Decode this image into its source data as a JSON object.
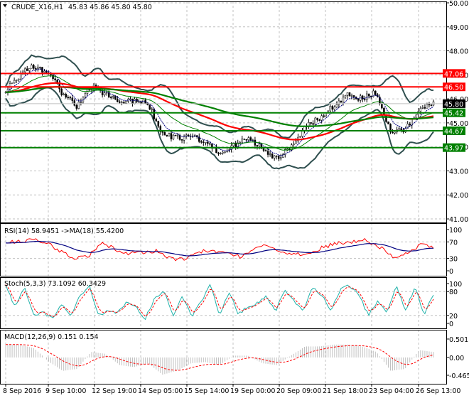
{
  "header": {
    "symbol": "CRUDE_X16,H1",
    "ohlc": "45.83 45.86 45.80 45.80"
  },
  "colors": {
    "up_level": "#ff0000",
    "down_level": "#008000",
    "bands": "#2f4f4f",
    "ma_fast": "#ff0000",
    "ma_slow": "#008000",
    "rsi": "#ff0000",
    "rsi_ma": "#000080",
    "stoch_main": "#20b2aa",
    "stoch_signal": "#ff0000",
    "macd_hist": "#c0c0c0"
  },
  "chart_data": [
    {
      "type": "line",
      "title": "CRUDE_X16,H1",
      "ylim": [
        41,
        50
      ],
      "yticks": [
        "50.00",
        "49.00",
        "48.00",
        "47.00",
        "46.00",
        "45.00",
        "44.00",
        "43.00",
        "42.00",
        "41.00"
      ],
      "xticks": [
        "8 Sep 2016",
        "9 Sep 10:00",
        "12 Sep 19:00",
        "14 Sep 05:00",
        "15 Sep 14:00",
        "19 Sep 00:00",
        "20 Sep 09:00",
        "21 Sep 18:00",
        "23 Sep 04:00",
        "26 Sep 13:00"
      ],
      "close": [
        46.4,
        47.0,
        47.4,
        47.1,
        46.2,
        45.7,
        46.5,
        46.2,
        45.9,
        45.9,
        45.8,
        44.5,
        44.4,
        44.4,
        44.2,
        43.7,
        44.1,
        44.3,
        44.0,
        43.5,
        44.0,
        44.8,
        45.2,
        45.7,
        46.2,
        46.0,
        46.3,
        44.6,
        44.7,
        45.5,
        45.8
      ],
      "current_price": "45.80",
      "levels": [
        {
          "value": "47.06",
          "kind": "resistance"
        },
        {
          "value": "46.50",
          "kind": "resistance"
        },
        {
          "value": "45.42",
          "kind": "support"
        },
        {
          "value": "44.67",
          "kind": "support"
        },
        {
          "value": "43.97",
          "kind": "support"
        }
      ]
    },
    {
      "type": "line",
      "title": "RSI(14) 58.9451  ->MA(18) 55.4200",
      "ylim": [
        0,
        100
      ],
      "yticks": [
        "100",
        "70",
        "30",
        "0"
      ],
      "values": [
        72,
        70,
        78,
        66,
        48,
        28,
        35,
        66,
        52,
        42,
        46,
        48,
        30,
        26,
        46,
        48,
        44,
        35,
        56,
        60,
        44,
        40,
        38,
        58,
        66,
        70,
        76,
        60,
        35,
        40,
        62,
        59
      ]
    },
    {
      "type": "line",
      "title": "Stoch(5,3,3) 73.1092 60.3429",
      "ylim": [
        0,
        100
      ],
      "yticks": [
        "100",
        "80",
        "20",
        "0"
      ],
      "values": [
        95,
        40,
        90,
        20,
        28,
        12,
        50,
        15,
        70,
        95,
        20,
        30,
        25,
        55,
        40,
        12,
        60,
        85,
        18,
        70,
        15,
        55,
        98,
        20,
        80,
        25,
        40,
        50,
        70,
        30,
        85,
        55,
        35,
        90,
        70,
        30,
        88,
        95,
        70,
        20,
        55,
        25,
        95,
        30,
        92,
        20,
        73
      ]
    },
    {
      "type": "bar",
      "title": "MACD(12,26,9) 0.151 0.154",
      "ylim": [
        -0.465,
        0.501
      ],
      "yticks": [
        "0.501",
        "0.00",
        "-0.465"
      ],
      "values": [
        0.35,
        0.35,
        0.25,
        -0.1,
        -0.35,
        -0.3,
        0.15,
        0.1,
        -0.2,
        -0.25,
        -0.15,
        -0.45,
        -0.35,
        -0.15,
        -0.12,
        -0.2,
        0.05,
        0.05,
        -0.15,
        -0.2,
        0.05,
        0.3,
        0.3,
        0.35,
        0.35,
        0.3,
        0.15,
        -0.35,
        -0.3,
        0.2,
        0.15
      ]
    }
  ]
}
